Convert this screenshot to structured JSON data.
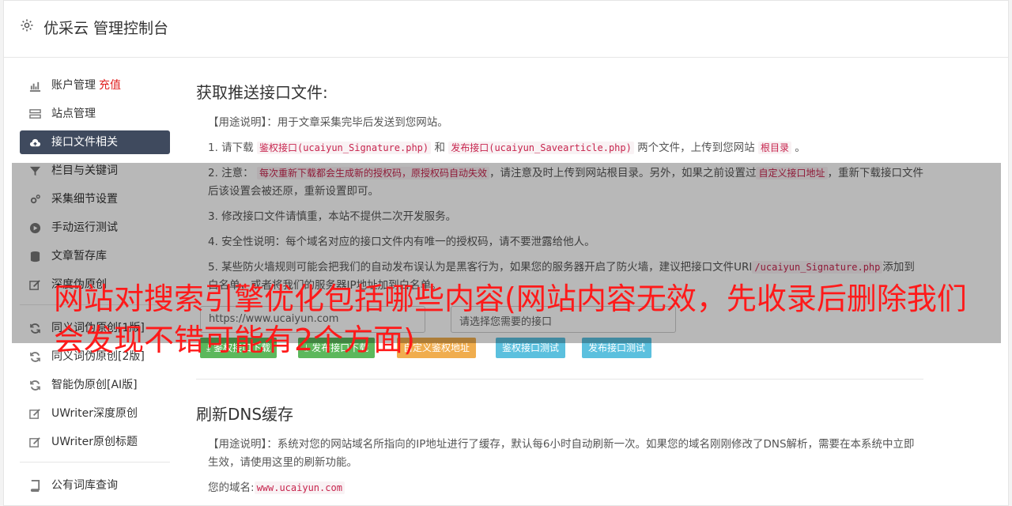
{
  "header": {
    "title": "优采云 管理控制台"
  },
  "sidebar": {
    "items": [
      {
        "label": "账户管理",
        "extra": "充值"
      },
      {
        "label": "站点管理"
      },
      {
        "label": "接口文件相关"
      },
      {
        "label": "栏目与关键词"
      },
      {
        "label": "采集细节设置"
      },
      {
        "label": "手动运行测试"
      },
      {
        "label": "文章暂存库"
      },
      {
        "label": "深度伪原创"
      },
      {
        "label": "同义词伪原创[1版]"
      },
      {
        "label": "同义词伪原创[2版]"
      },
      {
        "label": "智能伪原创[AI版]"
      },
      {
        "label": "UWriter深度原创"
      },
      {
        "label": "UWriter原创标题"
      },
      {
        "label": "公有词库查询"
      }
    ]
  },
  "section1": {
    "title": "获取推送接口文件:",
    "usage_label": "【用途说明】",
    "usage_text": "：用于文章采集完毕后发送到您网站。",
    "p1_prefix": "1. 请下载",
    "p1_code1": "鉴权接口(ucaiyun_Signature.php)",
    "p1_and": "和",
    "p1_code2": "发布接口(ucaiyun_Savearticle.php)",
    "p1_mid": "两个文件，上传到您网站",
    "p1_code3": "根目录",
    "p1_end": "。",
    "p2_prefix": "2. 注意：",
    "p2_code1": "每次重新下载都会生成新的授权码，原授权码自动失效",
    "p2_mid": "，请注意及时上传到网站根目录。另外，如果之前设置过",
    "p2_code2": "自定义接口地址",
    "p2_end": "，重新下载接口文件后该设置会被还原，重新设置即可。",
    "p3": "3. 修改接口文件请慎重，本站不提供二次开发服务。",
    "p4": "4. 安全性说明：每个域名对应的接口文件内有唯一的授权码，请不要泄露给他人。",
    "p5_prefix": "5. 某些防火墙规则可能会把我们的自动发布误认为是黑客行为，如果您的服务器开启了防火墙，建议把接口文件URI",
    "p5_code": "/ucaiyun_Signature.php",
    "p5_end": "添加到白名单，或者将我们的服务器IP地址加到白名单。",
    "site_input": "https://www.ucaiyun.com",
    "select_placeholder": "请选择您需要的接口",
    "buttons": [
      "鉴权接口下载",
      "发布接口下载",
      "自定义鉴权地址",
      "鉴权接口测试",
      "发布接口测试"
    ]
  },
  "section2": {
    "title": "刷新DNS缓存",
    "usage_label": "【用途说明】",
    "usage_text": "：系统对您的网站域名所指向的IP地址进行了缓存，默认每6小时自动刷新一次。如果您的域名刚刚修改了DNS解析，需要在本系统中立即生效，请使用这里的刷新功能。",
    "domain_label": "您的域名:",
    "domain_value": "www.ucaiyun.com"
  },
  "overlay_title": "网站对搜索引擎优化包括哪些内容(网站内容无效，先收录后删除我们会发现不错可能有2个方面)"
}
